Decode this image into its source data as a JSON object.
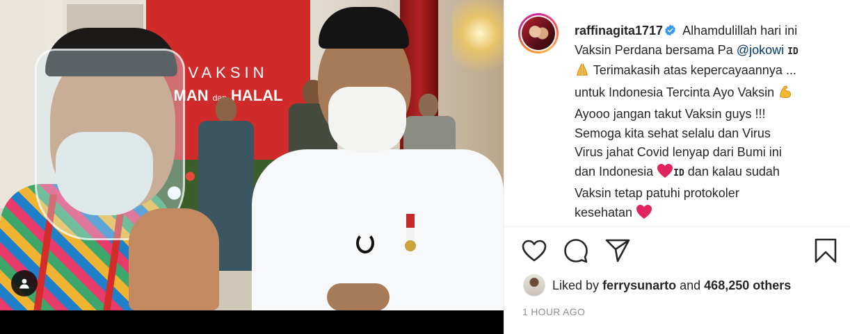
{
  "photo": {
    "backdrop_line1": "VAKSIN",
    "backdrop_line2_pre": "MAN",
    "backdrop_line2_mid": "dan",
    "backdrop_line2_post": "HALAL"
  },
  "post": {
    "username": "raffinagita1717",
    "caption": {
      "line1_text": "Alhamdulillah hari ini",
      "line2_pre": "Vaksin Perdana bersama Pa ",
      "mention": "@jokowi",
      "id_mark_1": "ID",
      "line3_text": "Terimakasih atas kepercayaannya ...",
      "line4_text": "untuk Indonesia Tercinta Ayo Vaksin",
      "line5_text": "Ayooo jangan takut Vaksin guys !!!",
      "line6_text": "Semoga kita sehat selalu dan Virus",
      "line7_text": "Virus jahat Covid lenyap dari Bumi ini",
      "line8_pre": "dan Indonesia",
      "id_mark_2": "ID",
      "line8_post": "dan kalau sudah",
      "line9_text": "Vaksin tetap patuhi protokoler",
      "line10_text": "kesehatan"
    },
    "likes": {
      "prefix": "Liked by",
      "liker": "ferrysunarto",
      "and": "and",
      "count": "468,250 others"
    },
    "timestamp": "1 HOUR AGO"
  },
  "colors": {
    "verified": "#3897f0",
    "heart_emoji": "#e0245e",
    "mention": "#00376b",
    "muted": "#8e8e8e"
  },
  "icons": [
    "user-tag-icon",
    "verified-badge-icon",
    "pray-emoji-icon",
    "flexed-biceps-emoji-icon",
    "red-heart-emoji-icon",
    "like-heart-icon",
    "comment-icon",
    "share-icon",
    "save-bookmark-icon"
  ]
}
